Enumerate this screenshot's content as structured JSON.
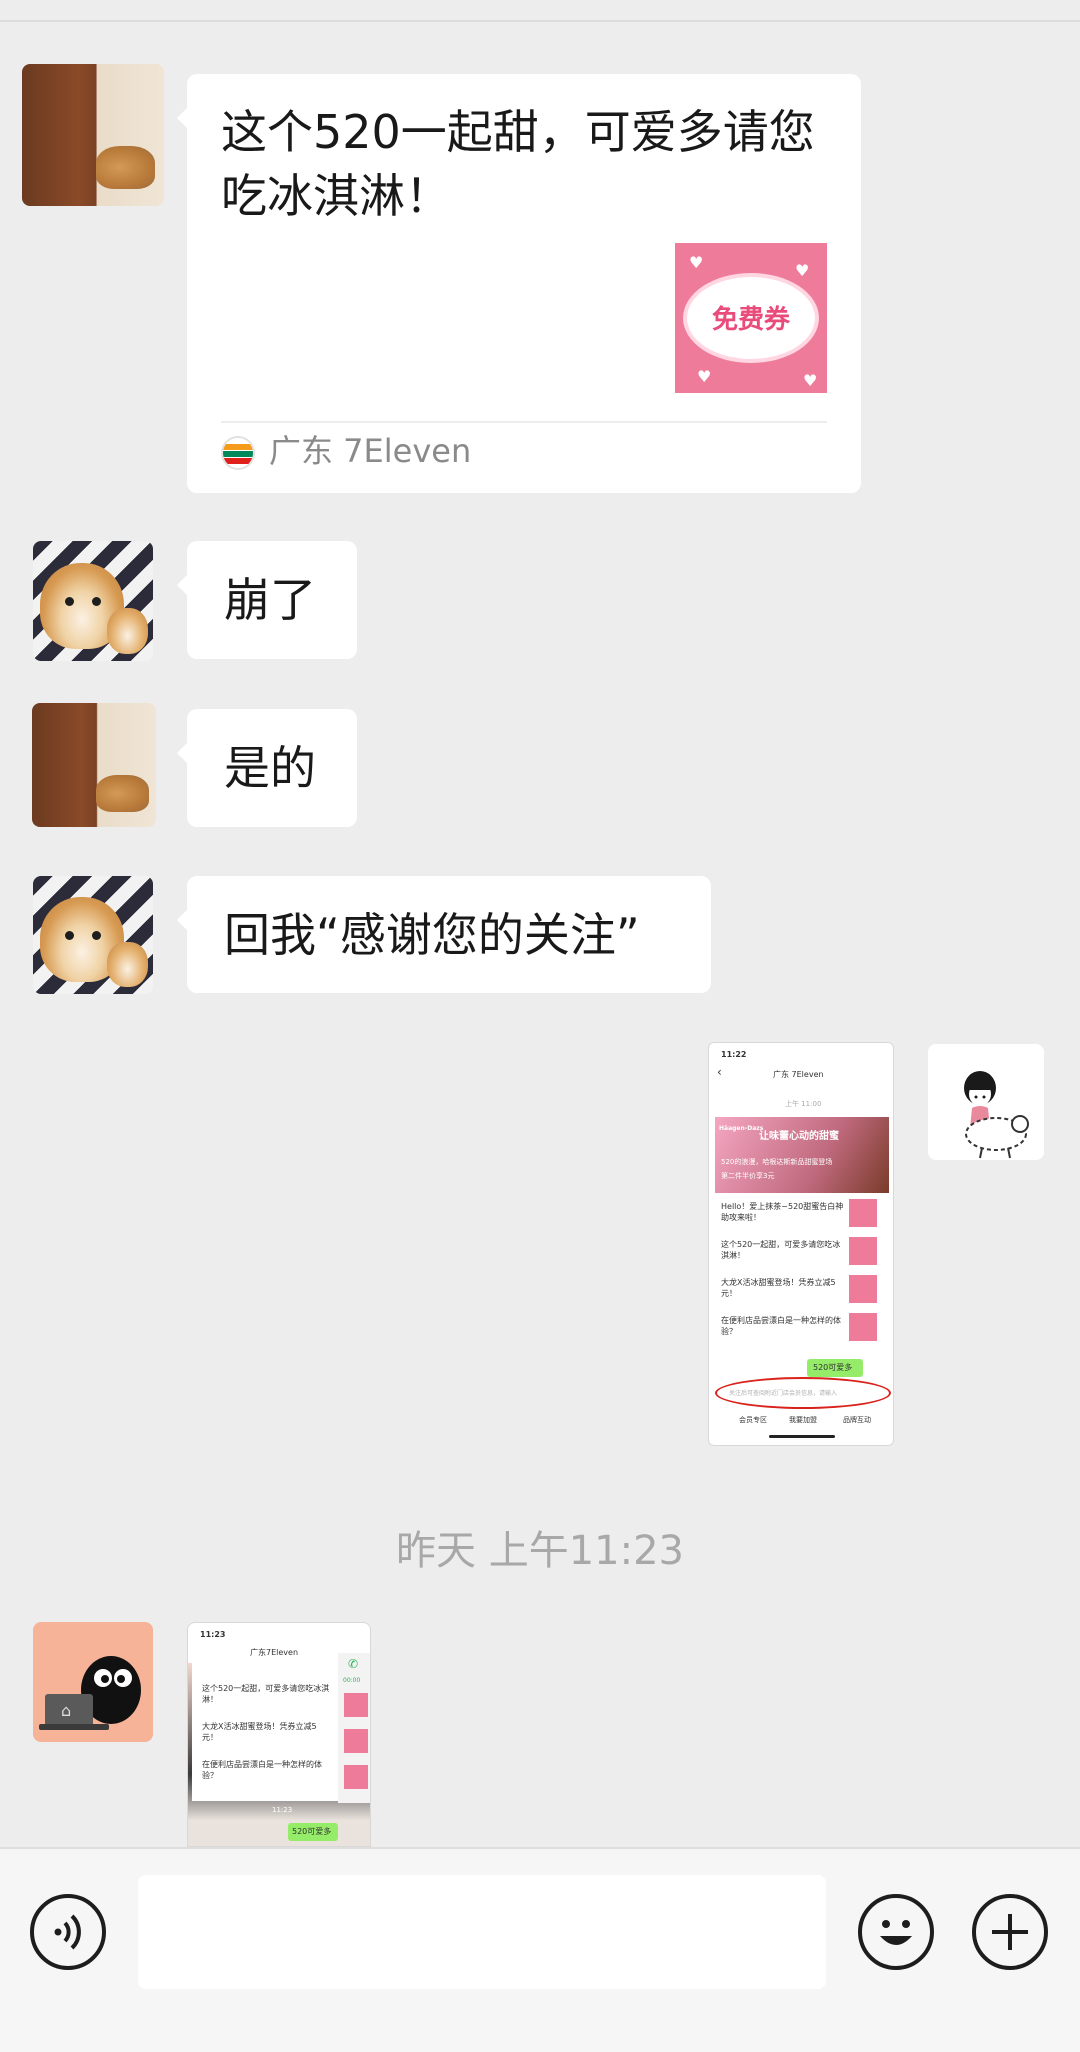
{
  "messages": {
    "card": {
      "title": "这个520一起甜，可爱多请您吃冰淇淋！",
      "thumb_label": "免费券",
      "source": "广东 7Eleven"
    },
    "m2": "崩了",
    "m3": "是的",
    "m4": "回我“感谢您的关注”"
  },
  "screenshot1": {
    "time": "11:22",
    "title": "广东 7Eleven",
    "date": "上午 11:00",
    "banner": "让味蕾心动的甜蜜",
    "brand": "Häagen-Dazs",
    "banner_line1": "520的浪漫，哈根达斯新品甜蜜登场",
    "banner_line2": "第二件半价享3元",
    "items": [
      "Hello！爱上抹茶~520甜蜜告白神助攻来啦！",
      "这个520一起甜，可爱多请您吃冰淇淋！",
      "大龙X活冰甜蜜登场！凭券立减5元！",
      "在便利店品尝漂白是一种怎样的体验？"
    ],
    "green_msg": "520可爱多",
    "input_hint": "关注后可查阅附近门店会员信息，请输入",
    "tabs": [
      "会员专区",
      "我要加盟",
      "品牌互动"
    ]
  },
  "timestamp": "昨天 上午11:23",
  "screenshot2": {
    "time": "11:23",
    "title": "广东7Eleven",
    "items": [
      "这个520一起甜，可爱多请您吃冰淇淋！",
      "大龙X活冰甜蜜登场！凭券立减5元！",
      "在便利店品尝漂白是一种怎样的体验？"
    ],
    "call_time": "00:00",
    "video_time": "11:23",
    "green_msg": "520可爱多"
  },
  "colors": {
    "background": "#ededed",
    "bubble": "#ffffff",
    "wechat_green": "#95ec69",
    "timestamp": "#a8a8a8",
    "coupon_pink": "#ee7b9a"
  }
}
